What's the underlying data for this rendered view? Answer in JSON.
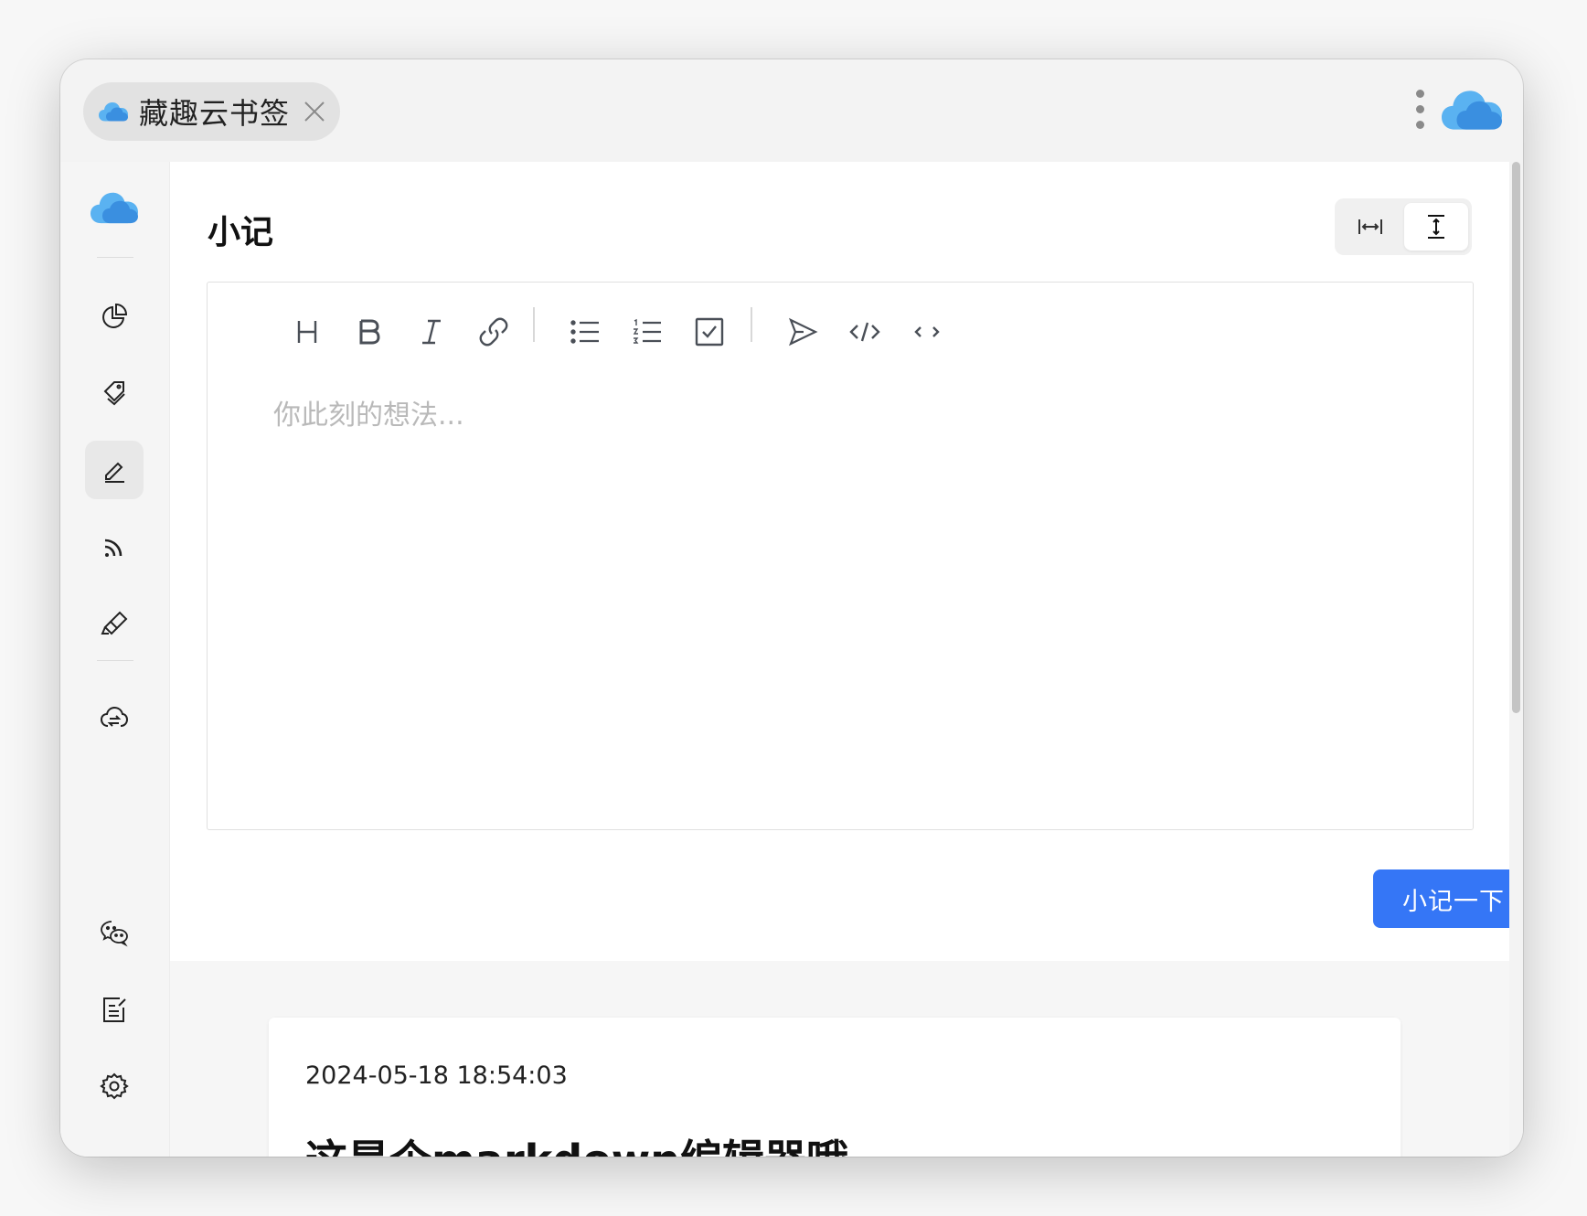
{
  "titlebar": {
    "tab_title": "藏趣云书签",
    "tab_icon": "cloud-logo-icon",
    "close_icon": "close-icon",
    "menu_icon": "more-vertical-icon",
    "app_icon": "cloud-logo-icon"
  },
  "sidebar": {
    "logo_icon": "cloud-logo-icon",
    "items": [
      {
        "name": "dashboard",
        "icon": "pie-chart-icon",
        "active": false
      },
      {
        "name": "tags",
        "icon": "tags-icon",
        "active": false
      },
      {
        "name": "notes",
        "icon": "pen-icon",
        "active": true
      },
      {
        "name": "rss",
        "icon": "rss-icon",
        "active": false
      },
      {
        "name": "highlight",
        "icon": "highlighter-icon",
        "active": false
      },
      {
        "name": "sync",
        "icon": "cloud-sync-icon",
        "active": false
      },
      {
        "name": "wechat",
        "icon": "wechat-icon",
        "active": false
      },
      {
        "name": "edit-doc",
        "icon": "edit-document-icon",
        "active": false
      },
      {
        "name": "settings",
        "icon": "gear-icon",
        "active": false
      }
    ]
  },
  "main": {
    "title": "小记",
    "view_toggle": [
      {
        "icon": "fit-width-icon",
        "selected": false
      },
      {
        "icon": "fit-height-icon",
        "selected": true
      }
    ],
    "toolbar": [
      {
        "name": "heading",
        "icon": "heading-icon"
      },
      {
        "name": "bold",
        "icon": "bold-icon"
      },
      {
        "name": "italic",
        "icon": "italic-icon"
      },
      {
        "name": "link",
        "icon": "link-icon"
      },
      {
        "name": "bullet-list",
        "icon": "bullet-list-icon"
      },
      {
        "name": "ordered-list",
        "icon": "ordered-list-icon"
      },
      {
        "name": "checkbox",
        "icon": "checkbox-icon"
      },
      {
        "name": "send",
        "icon": "send-icon"
      },
      {
        "name": "code-block",
        "icon": "code-block-icon"
      },
      {
        "name": "inline-code",
        "icon": "inline-code-icon"
      }
    ],
    "editor": {
      "placeholder": "你此刻的想法...",
      "value": ""
    },
    "submit_label": "小记一下",
    "submit_color": "#3576f6",
    "notes": [
      {
        "time": "2024-05-18 18:54:03",
        "heading": "这是个markdown编辑器哦"
      }
    ]
  },
  "colors": {
    "accent": "#3576f6",
    "cloud_light": "#5ab2f1",
    "cloud_dark": "#3a8fe0"
  }
}
